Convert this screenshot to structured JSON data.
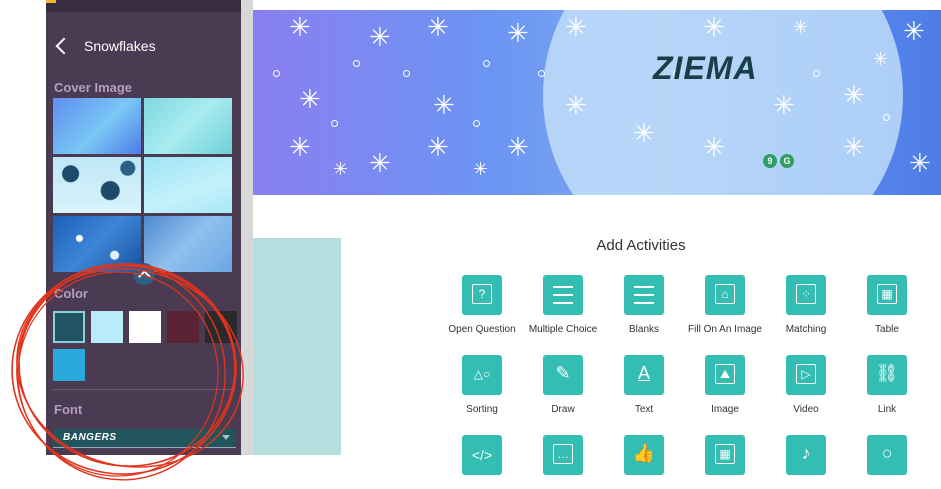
{
  "sidebar": {
    "title": "Snowflakes",
    "cover_label": "Cover Image",
    "color_label": "Color",
    "font_label": "Font",
    "font_value": "BANGERS",
    "swatches": [
      "#1f5460",
      "#b8ecfa",
      "#ffffff",
      "#5a2233",
      "#2a2a2a",
      "#29a8dc"
    ]
  },
  "cover": {
    "title": "ZIEMA",
    "badge_1": "9",
    "badge_2": "G"
  },
  "activities": {
    "title": "Add Activities",
    "items": [
      {
        "label": "Open Question",
        "icon": "question-icon"
      },
      {
        "label": "Multiple Choice",
        "icon": "list-icon"
      },
      {
        "label": "Blanks",
        "icon": "blanks-icon"
      },
      {
        "label": "Fill On An Image",
        "icon": "fill-image-icon"
      },
      {
        "label": "Matching",
        "icon": "matching-icon"
      },
      {
        "label": "Table",
        "icon": "table-icon"
      },
      {
        "label": "Sorting",
        "icon": "sorting-icon"
      },
      {
        "label": "Draw",
        "icon": "pencil-icon"
      },
      {
        "label": "Text",
        "icon": "text-icon"
      },
      {
        "label": "Image",
        "icon": "image-icon"
      },
      {
        "label": "Video",
        "icon": "video-icon"
      },
      {
        "label": "Link",
        "icon": "link-icon"
      }
    ]
  },
  "colors": {
    "sidebar_bg": "#4a3a52",
    "accent_teal": "#34bdb2",
    "annotation_red": "#e2341d"
  }
}
